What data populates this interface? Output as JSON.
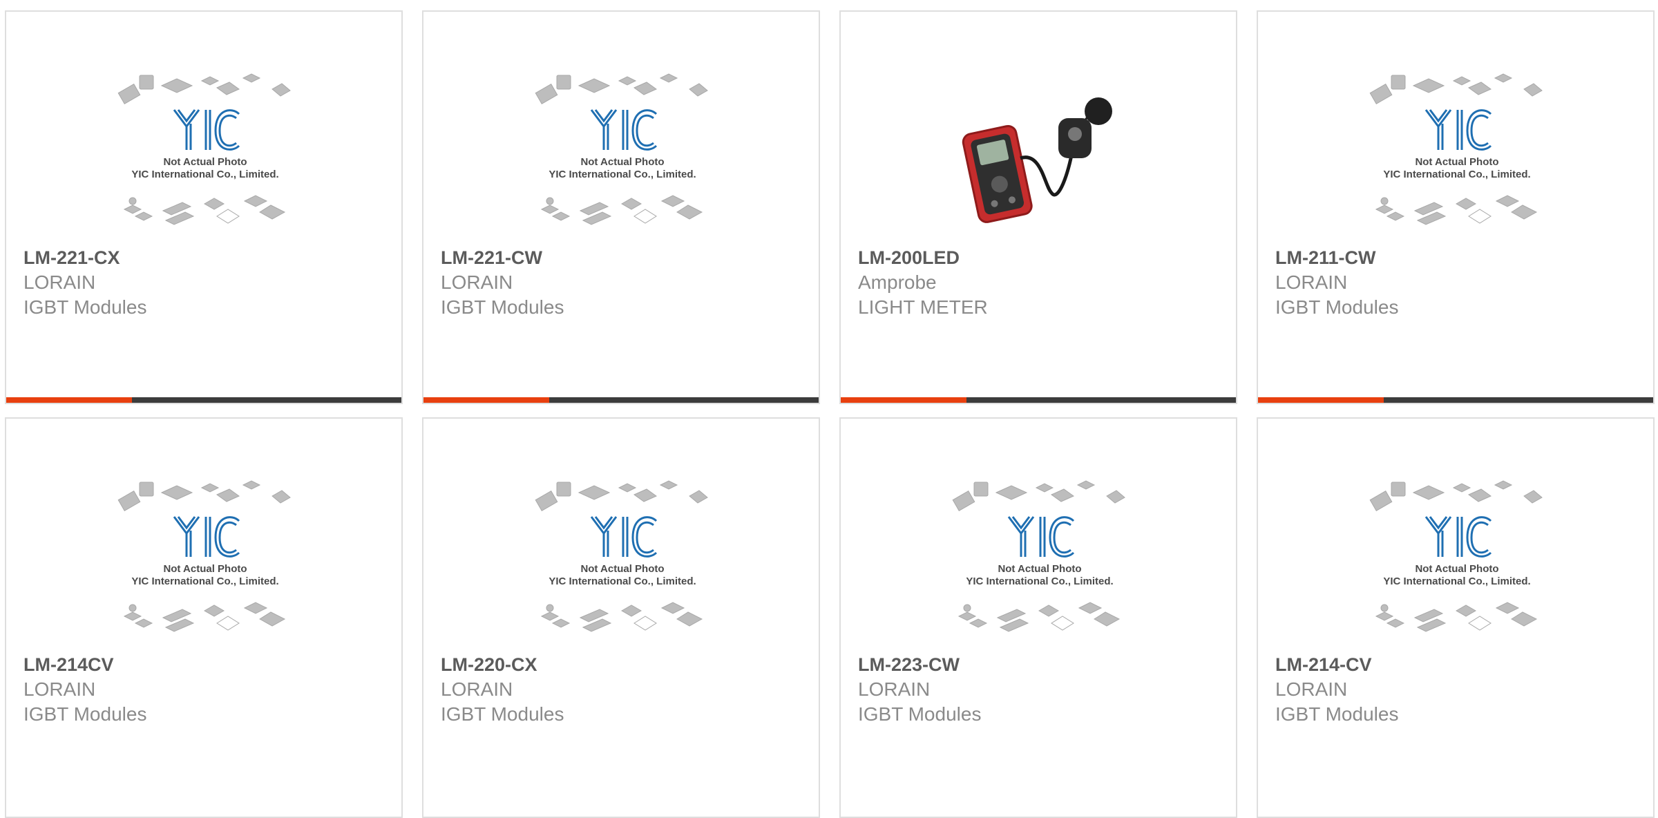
{
  "placeholder": {
    "logo_text": "YIC",
    "line1": "Not Actual Photo",
    "line2": "YIC International Co., Limited."
  },
  "products": [
    {
      "part": "LM-221-CX",
      "maker": "LORAIN",
      "category": "IGBT Modules",
      "image": "placeholder"
    },
    {
      "part": "LM-221-CW",
      "maker": "LORAIN",
      "category": "IGBT Modules",
      "image": "placeholder"
    },
    {
      "part": "LM-200LED",
      "maker": "Amprobe",
      "category": "LIGHT METER",
      "image": "light-meter-photo"
    },
    {
      "part": "LM-211-CW",
      "maker": "LORAIN",
      "category": "IGBT Modules",
      "image": "placeholder"
    },
    {
      "part": "LM-214CV",
      "maker": "LORAIN",
      "category": "IGBT Modules",
      "image": "placeholder"
    },
    {
      "part": "LM-220-CX",
      "maker": "LORAIN",
      "category": "IGBT Modules",
      "image": "placeholder"
    },
    {
      "part": "LM-223-CW",
      "maker": "LORAIN",
      "category": "IGBT Modules",
      "image": "placeholder"
    },
    {
      "part": "LM-214-CV",
      "maker": "LORAIN",
      "category": "IGBT Modules",
      "image": "placeholder"
    }
  ],
  "colors": {
    "accent": "#e8400f",
    "bar": "#3c3c3c",
    "logo": "#1f6fb2",
    "text_dark": "#5b5b5b",
    "text_light": "#8a8a8a"
  }
}
